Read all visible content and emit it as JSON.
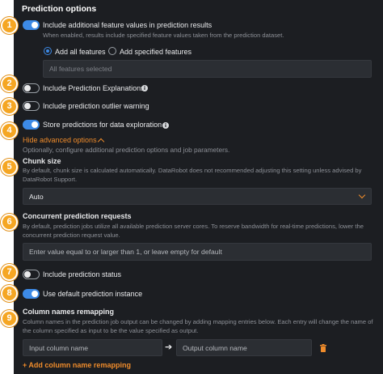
{
  "header": {
    "title": "Prediction options"
  },
  "include_features": {
    "label": "Include additional feature values in prediction results",
    "help": "When enabled, results include specified feature values taken from the prediction dataset.",
    "radio_all": "Add all features",
    "radio_specified": "Add specified features",
    "selected_radio": "Add all features",
    "field_value": "All features selected",
    "enabled": true
  },
  "explanations": {
    "label": "Include Prediction Explanations",
    "enabled": false
  },
  "outlier": {
    "label": "Include prediction outlier warning",
    "enabled": false
  },
  "store": {
    "label": "Store predictions for data exploration",
    "enabled": true
  },
  "advanced": {
    "link": "Hide advanced options",
    "help": "Optionally, configure additional prediction options and job parameters."
  },
  "chunk": {
    "title": "Chunk size",
    "help": "By default, chunk size is calculated automatically. DataRobot does not recommended adjusting this setting unless advised by DataRobot Support.",
    "value": "Auto"
  },
  "concurrent": {
    "title": "Concurrent prediction requests",
    "help": "By default, prediction jobs utilize all available prediction server cores. To reserve bandwidth for real-time predictions, lower the concurrent prediction request value.",
    "placeholder": "Enter value equal to or larger than 1, or leave empty for default"
  },
  "status": {
    "label": "Include prediction status",
    "enabled": false
  },
  "default_instance": {
    "label": "Use default prediction instance",
    "enabled": true
  },
  "remapping": {
    "title": "Column names remapping",
    "help": "Column names in the prediction job output can be changed by adding mapping entries below. Each entry will change the name of the column specified as input to be the value specified as output.",
    "input_placeholder": "Input column name",
    "output_placeholder": "Output column name",
    "add_label": "+ Add column name remapping"
  },
  "badges": [
    "1",
    "2",
    "3",
    "4",
    "5",
    "6",
    "7",
    "8",
    "9"
  ],
  "colors": {
    "accent": "#3d8ae6",
    "link": "#f08c2b",
    "badge": "#f5a623",
    "background": "#1c1e22"
  }
}
